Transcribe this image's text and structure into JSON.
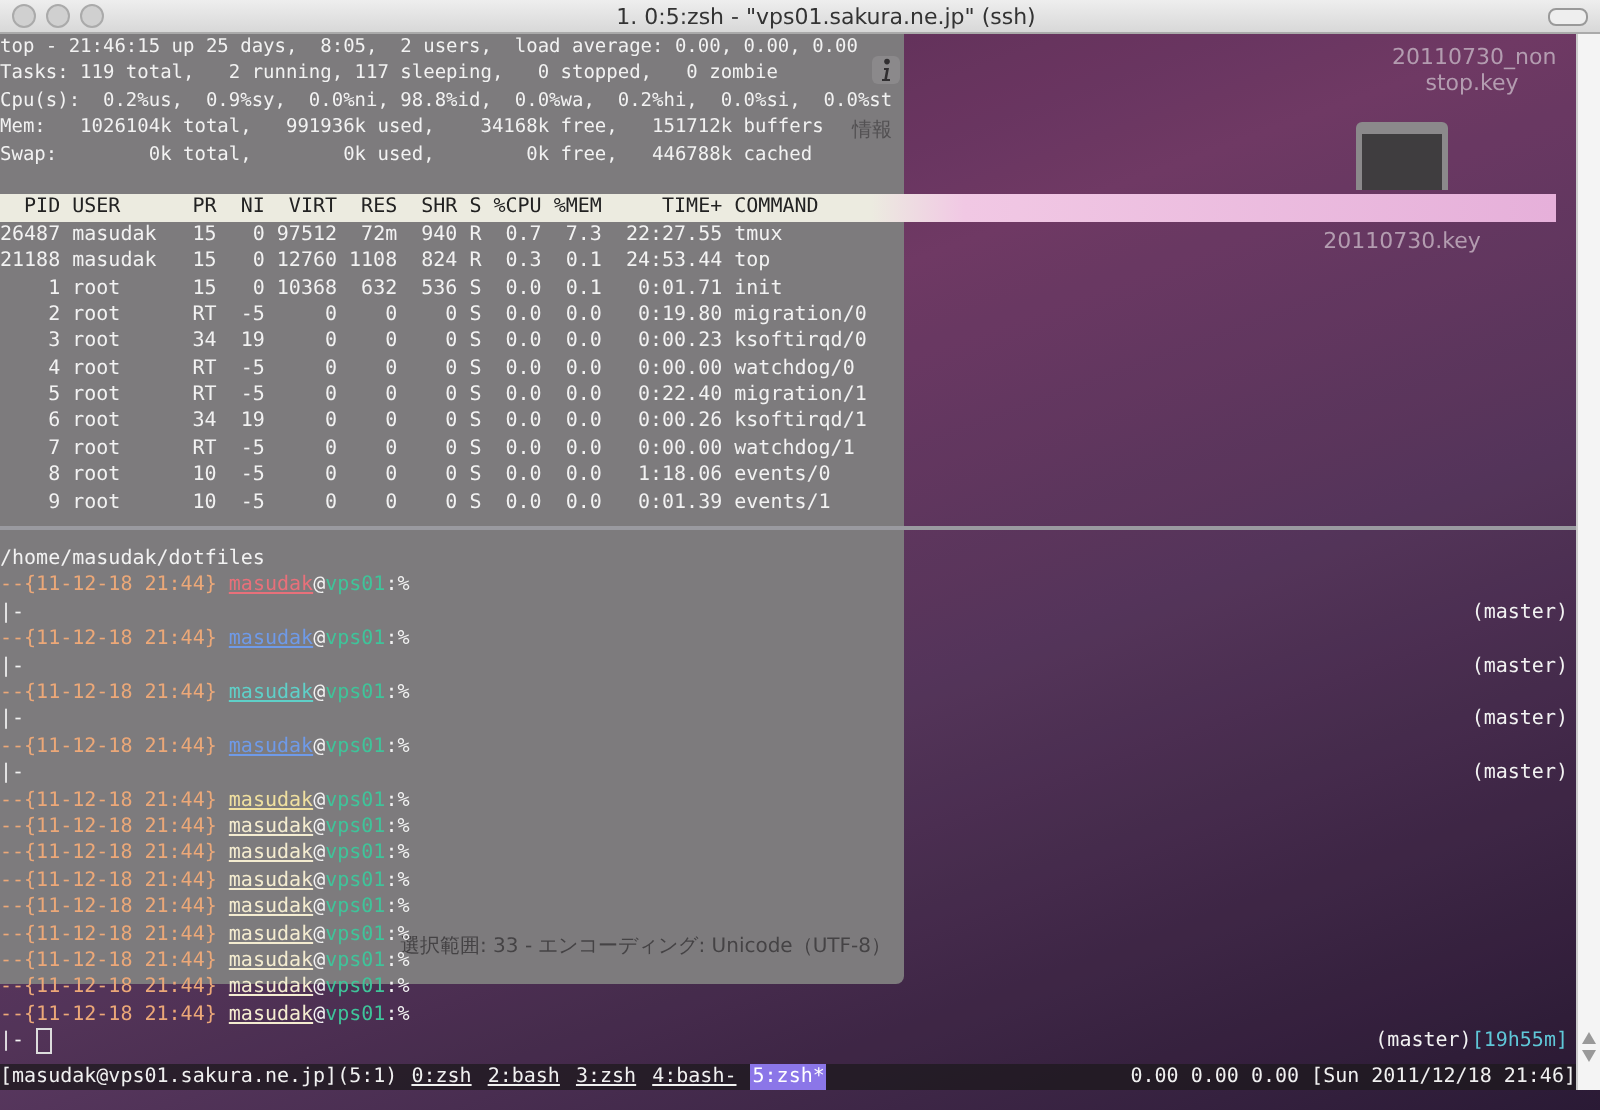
{
  "window": {
    "title": "1. 0:5:zsh - \"vps01.sakura.ne.jp\" (ssh)"
  },
  "desktop": {
    "icons": [
      {
        "kind": "plain",
        "label": "20110730_non stop.key"
      },
      {
        "kind": "thumbnail",
        "label": "20110730.key"
      }
    ],
    "back_window": {
      "toolbar_label": "情報",
      "status": "選択範囲: 33 - エンコーディング: Unicode（UTF-8）"
    }
  },
  "top": {
    "summary": [
      "top - 21:46:15 up 25 days,  8:05,  2 users,  load average: 0.00, 0.00, 0.00",
      "Tasks: 119 total,   2 running, 117 sleeping,   0 stopped,   0 zombie",
      "Cpu(s):  0.2%us,  0.9%sy,  0.0%ni, 98.8%id,  0.0%wa,  0.2%hi,  0.0%si,  0.0%st",
      "Mem:   1026104k total,   991936k used,    34168k free,   151712k buffers",
      "Swap:        0k total,        0k used,        0k free,   446788k cached"
    ],
    "columns": [
      "PID",
      "USER",
      "PR",
      "NI",
      "VIRT",
      "RES",
      "SHR",
      "S",
      "%CPU",
      "%MEM",
      "TIME+",
      "COMMAND"
    ],
    "rows": [
      [
        "26487",
        "masudak",
        "15",
        "0",
        "97512",
        "72m",
        "940",
        "R",
        "0.7",
        "7.3",
        "22:27.55",
        "tmux"
      ],
      [
        "21188",
        "masudak",
        "15",
        "0",
        "12760",
        "1108",
        "824",
        "R",
        "0.3",
        "0.1",
        "24:53.44",
        "top"
      ],
      [
        "1",
        "root",
        "15",
        "0",
        "10368",
        "632",
        "536",
        "S",
        "0.0",
        "0.1",
        "0:01.71",
        "init"
      ],
      [
        "2",
        "root",
        "RT",
        "-5",
        "0",
        "0",
        "0",
        "S",
        "0.0",
        "0.0",
        "0:19.80",
        "migration/0"
      ],
      [
        "3",
        "root",
        "34",
        "19",
        "0",
        "0",
        "0",
        "S",
        "0.0",
        "0.0",
        "0:00.23",
        "ksoftirqd/0"
      ],
      [
        "4",
        "root",
        "RT",
        "-5",
        "0",
        "0",
        "0",
        "S",
        "0.0",
        "0.0",
        "0:00.00",
        "watchdog/0"
      ],
      [
        "5",
        "root",
        "RT",
        "-5",
        "0",
        "0",
        "0",
        "S",
        "0.0",
        "0.0",
        "0:22.40",
        "migration/1"
      ],
      [
        "6",
        "root",
        "34",
        "19",
        "0",
        "0",
        "0",
        "S",
        "0.0",
        "0.0",
        "0:00.26",
        "ksoftirqd/1"
      ],
      [
        "7",
        "root",
        "RT",
        "-5",
        "0",
        "0",
        "0",
        "S",
        "0.0",
        "0.0",
        "0:00.00",
        "watchdog/1"
      ],
      [
        "8",
        "root",
        "10",
        "-5",
        "0",
        "0",
        "0",
        "S",
        "0.0",
        "0.0",
        "1:18.06",
        "events/0"
      ],
      [
        "9",
        "root",
        "10",
        "-5",
        "0",
        "0",
        "0",
        "S",
        "0.0",
        "0.0",
        "0:01.39",
        "events/1"
      ]
    ]
  },
  "shell": {
    "cwd": "/home/masudak/dotfiles",
    "lines": [
      {
        "kind": "prompt",
        "stamp": "--{11-12-18 21:44}",
        "user": "masudak",
        "at": "@",
        "host": "vps01",
        "tail": ":%",
        "color": "#e8707a"
      },
      {
        "kind": "continuation",
        "text": "|-",
        "rprompt": "(master)"
      },
      {
        "kind": "prompt",
        "stamp": "--{11-12-18 21:44}",
        "user": "masudak",
        "at": "@",
        "host": "vps01",
        "tail": ":%",
        "color": "#6f9ae8"
      },
      {
        "kind": "continuation",
        "text": "|-",
        "rprompt": "(master)"
      },
      {
        "kind": "prompt",
        "stamp": "--{11-12-18 21:44}",
        "user": "masudak",
        "at": "@",
        "host": "vps01",
        "tail": ":%",
        "color": "#5fd0c8"
      },
      {
        "kind": "continuation",
        "text": "|-",
        "rprompt": "(master)"
      },
      {
        "kind": "prompt",
        "stamp": "--{11-12-18 21:44}",
        "user": "masudak",
        "at": "@",
        "host": "vps01",
        "tail": ":%",
        "color": "#6f9ae8"
      },
      {
        "kind": "continuation",
        "text": "|-",
        "rprompt": "(master)"
      },
      {
        "kind": "prompt",
        "stamp": "--{11-12-18 21:44}",
        "user": "masudak",
        "at": "@",
        "host": "vps01",
        "tail": ":%",
        "color": "#f0e0a0"
      },
      {
        "kind": "prompt",
        "stamp": "--{11-12-18 21:44}",
        "user": "masudak",
        "at": "@",
        "host": "vps01",
        "tail": ":%",
        "color": "#f4ecd0"
      },
      {
        "kind": "prompt",
        "stamp": "--{11-12-18 21:44}",
        "user": "masudak",
        "at": "@",
        "host": "vps01",
        "tail": ":%",
        "color": "#f4ecd0"
      },
      {
        "kind": "prompt",
        "stamp": "--{11-12-18 21:44}",
        "user": "masudak",
        "at": "@",
        "host": "vps01",
        "tail": ":%",
        "color": "#f4ecd0"
      },
      {
        "kind": "prompt",
        "stamp": "--{11-12-18 21:44}",
        "user": "masudak",
        "at": "@",
        "host": "vps01",
        "tail": ":%",
        "color": "#f4ecd0"
      },
      {
        "kind": "prompt",
        "stamp": "--{11-12-18 21:44}",
        "user": "masudak",
        "at": "@",
        "host": "vps01",
        "tail": ":%",
        "color": "#f4ecd0"
      },
      {
        "kind": "prompt",
        "stamp": "--{11-12-18 21:44}",
        "user": "masudak",
        "at": "@",
        "host": "vps01",
        "tail": ":%",
        "color": "#f4ecd0"
      },
      {
        "kind": "prompt",
        "stamp": "--{11-12-18 21:44}",
        "user": "masudak",
        "at": "@",
        "host": "vps01",
        "tail": ":%",
        "color": "#f4ecd0"
      },
      {
        "kind": "prompt",
        "stamp": "--{11-12-18 21:44}",
        "user": "masudak",
        "at": "@",
        "host": "vps01",
        "tail": ":%",
        "color": "#f4ecd0"
      },
      {
        "kind": "continuation",
        "text": "|-",
        "cursor": true,
        "rprompt": "(master)",
        "timer": "[19h55m]"
      }
    ]
  },
  "status_bar": {
    "session": "[masudak@vps01.sakura.ne.jp](5:1)",
    "windows": [
      {
        "label": "0:zsh",
        "selected": false
      },
      {
        "label": "2:bash",
        "selected": false
      },
      {
        "label": "3:zsh",
        "selected": false
      },
      {
        "label": "4:bash-",
        "selected": false
      },
      {
        "label": "5:zsh*",
        "selected": true
      }
    ],
    "right": "0.00 0.00 0.00 [Sun 2011/12/18 21:46]"
  }
}
